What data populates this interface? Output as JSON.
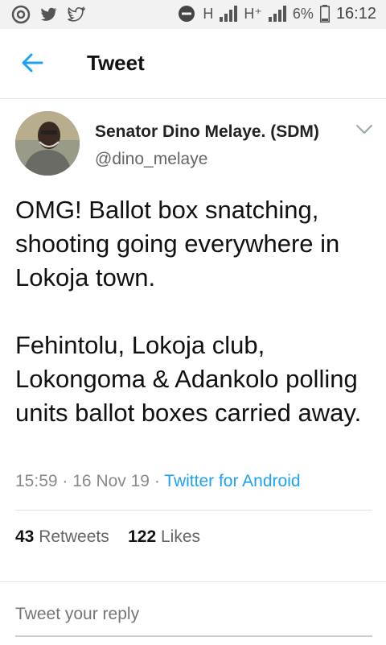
{
  "status_bar": {
    "network_h": "H",
    "network_hplus": "H⁺",
    "battery": "6%",
    "time": "16:12",
    "icons": [
      "chrome-icon",
      "twitter-icon",
      "twitter-outline-icon",
      "data-saver-icon",
      "signal-icon",
      "battery-icon"
    ]
  },
  "header": {
    "title": "Tweet",
    "back_icon": "arrow-left-icon",
    "accent": "#1da1f2"
  },
  "tweet": {
    "author_name": "Senator Dino Melaye. (SDM)",
    "author_handle": "@dino_melaye",
    "text_paragraph_1": "OMG! Ballot box snatching, shooting going everywhere in Lokoja town.",
    "text_paragraph_2": "Fehintolu, Lokoja club, Lokongoma & Adankolo polling units ballot boxes carried away.",
    "time": "15:59",
    "separator": "·",
    "date": "16 Nov 19",
    "source": "Twitter for Android",
    "retweets_count": "43",
    "retweets_label": "Retweets",
    "likes_count": "122",
    "likes_label": "Likes"
  },
  "reply": {
    "placeholder": "Tweet your reply"
  }
}
